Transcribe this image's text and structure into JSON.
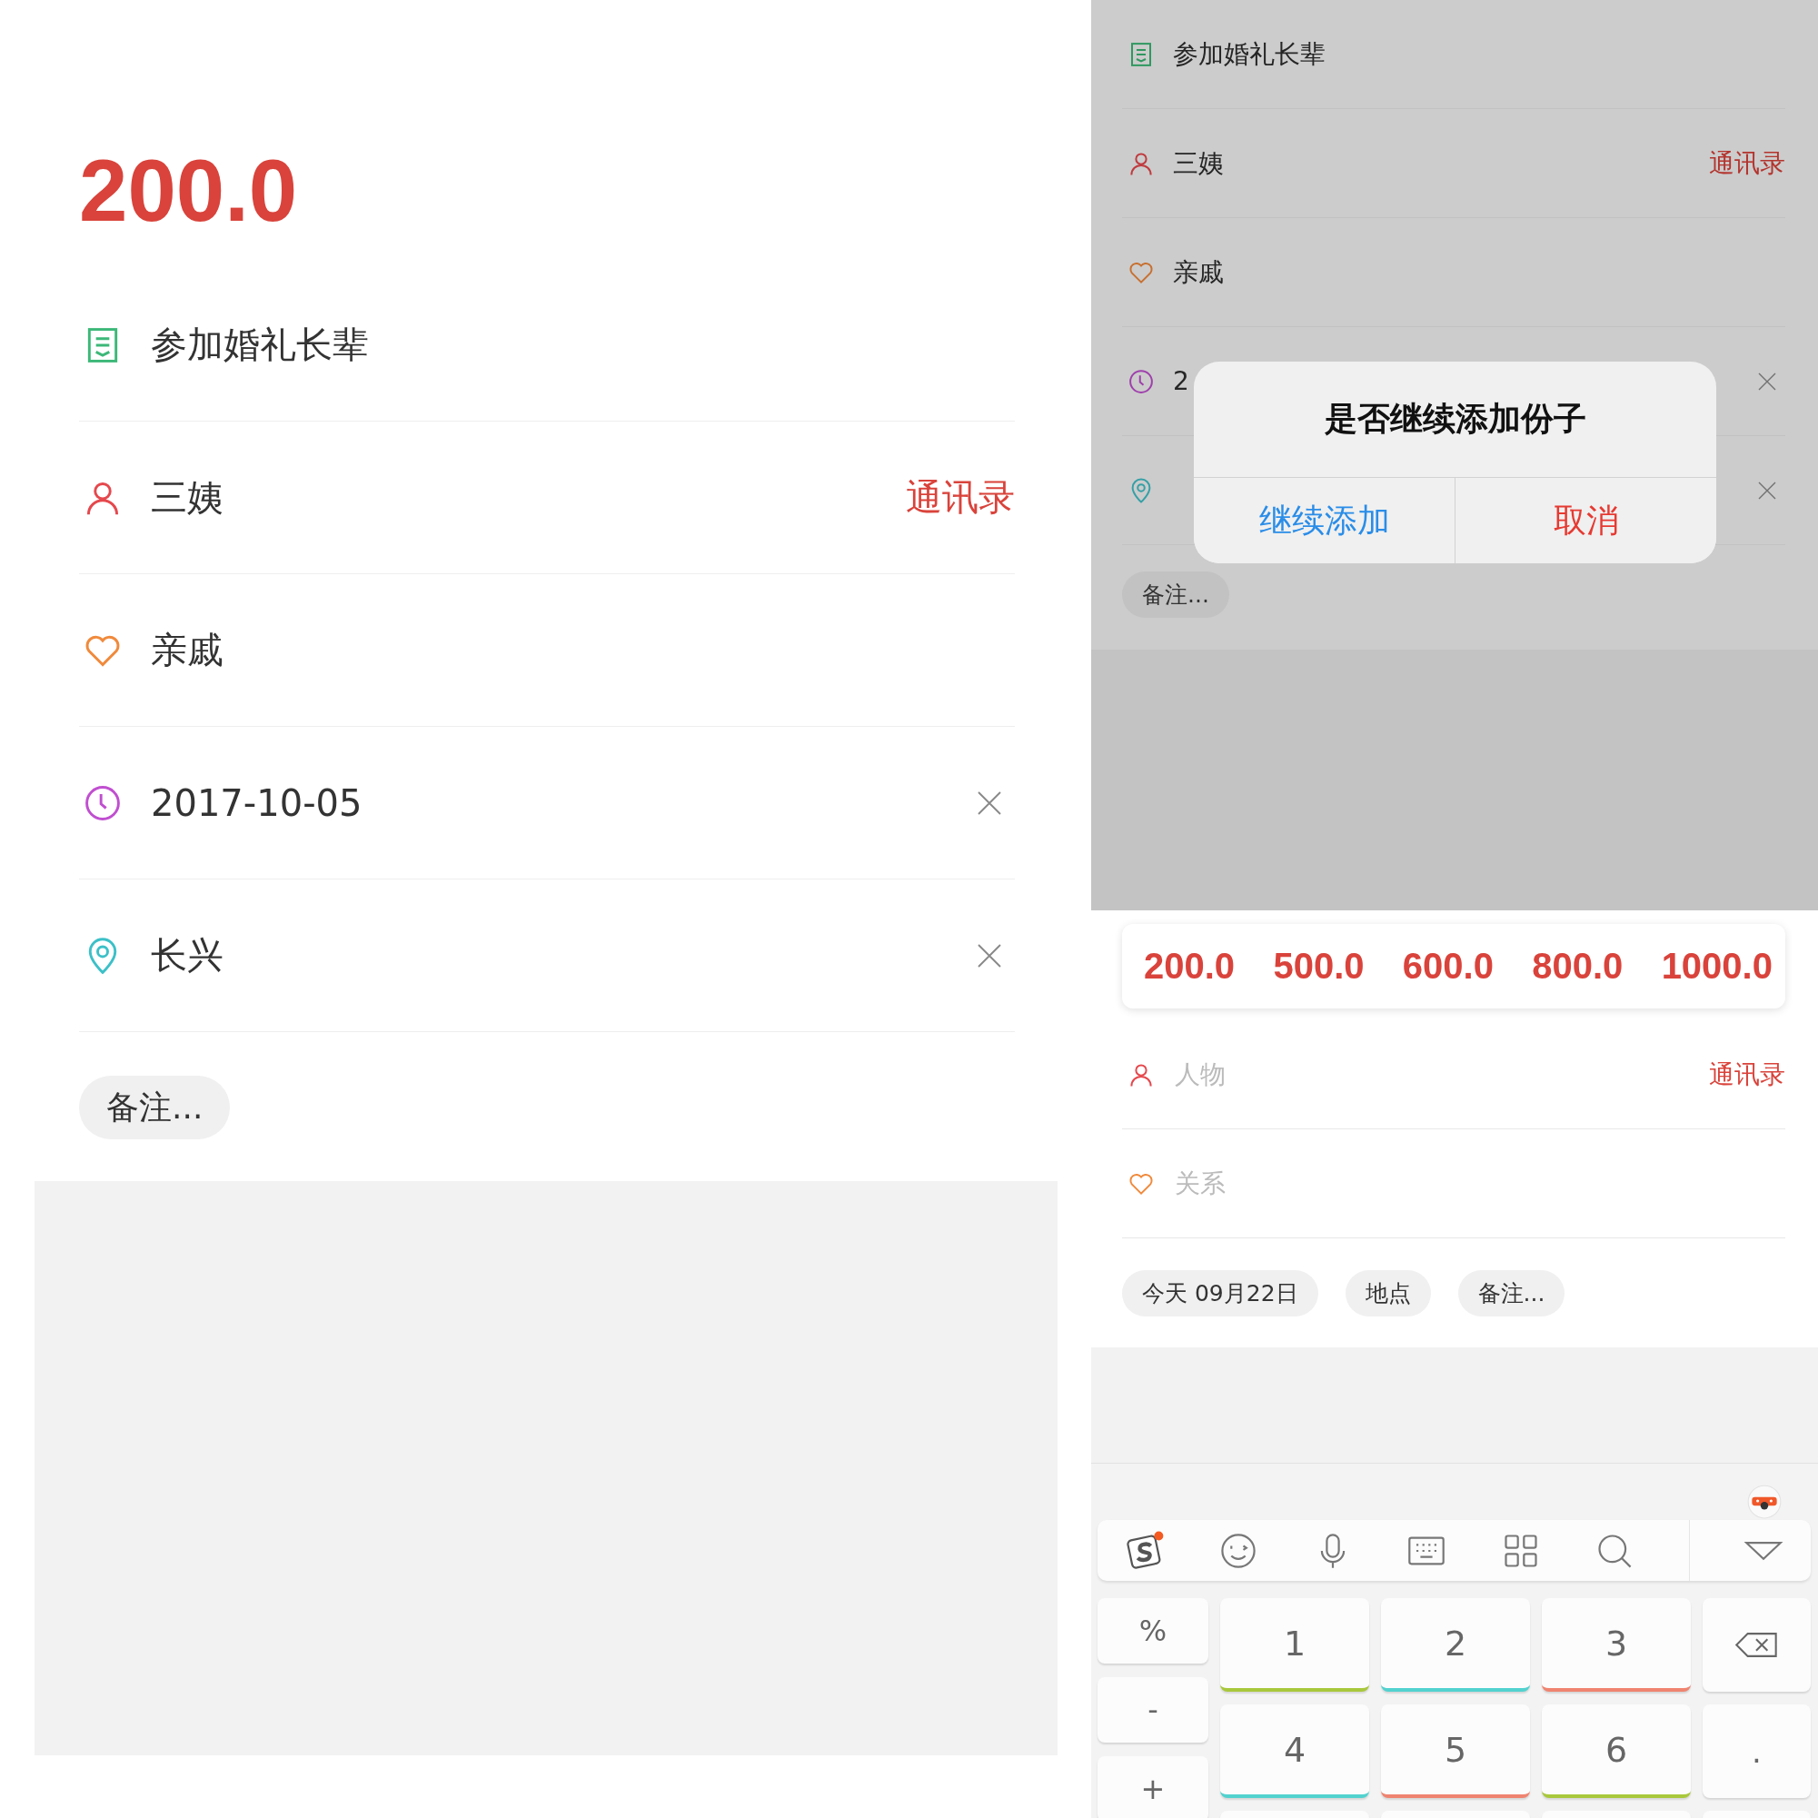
{
  "left": {
    "amount": "200.0",
    "rows": [
      {
        "kind": "title",
        "text": "参加婚礼长辈",
        "clearable": false
      },
      {
        "kind": "person",
        "text": "三姨",
        "action": "通讯录",
        "clearable": false
      },
      {
        "kind": "relation",
        "text": "亲戚",
        "clearable": false
      },
      {
        "kind": "date",
        "text": "2017-10-05",
        "clearable": true
      },
      {
        "kind": "place",
        "text": "长兴",
        "clearable": true
      }
    ],
    "note_chip": "备注..."
  },
  "right_top": {
    "rows": [
      {
        "kind": "title",
        "text": "参加婚礼长辈",
        "clearable": false
      },
      {
        "kind": "person",
        "text": "三姨",
        "action": "通讯录",
        "clearable": false
      },
      {
        "kind": "relation",
        "text": "亲戚",
        "clearable": false
      },
      {
        "kind": "date",
        "text": "2",
        "clearable": true
      },
      {
        "kind": "place",
        "clearable": true
      }
    ],
    "note_chip": "备注...",
    "dialog": {
      "title": "是否继续添加份子",
      "buttons": [
        {
          "label": "继续添加",
          "kind": "confirm"
        },
        {
          "label": "取消",
          "kind": "cancel"
        }
      ]
    }
  },
  "right_bottom": {
    "amounts": [
      "200.0",
      "500.0",
      "600.0",
      "800.0",
      "1000.0"
    ],
    "rows": [
      {
        "kind": "person",
        "placeholder": "人物",
        "action": "通讯录"
      },
      {
        "kind": "relation",
        "placeholder": "关系"
      }
    ],
    "chips": [
      "今天 09月22日",
      "地点",
      "备注..."
    ],
    "keyboard": {
      "side_keys": [
        "%",
        "-",
        "+"
      ],
      "keys": [
        {
          "label": "1",
          "color": "#a9c83c"
        },
        {
          "label": "2",
          "color": "#52d2cf"
        },
        {
          "label": "3",
          "color": "#ef8470"
        },
        {
          "label": "4",
          "color": "#52d2cf"
        },
        {
          "label": "5",
          "color": "#ef8470"
        },
        {
          "label": "6",
          "color": "#a9c83c"
        }
      ],
      "right_keys": [
        {
          "kind": "backspace"
        },
        {
          "kind": "text",
          "label": "."
        }
      ]
    }
  }
}
